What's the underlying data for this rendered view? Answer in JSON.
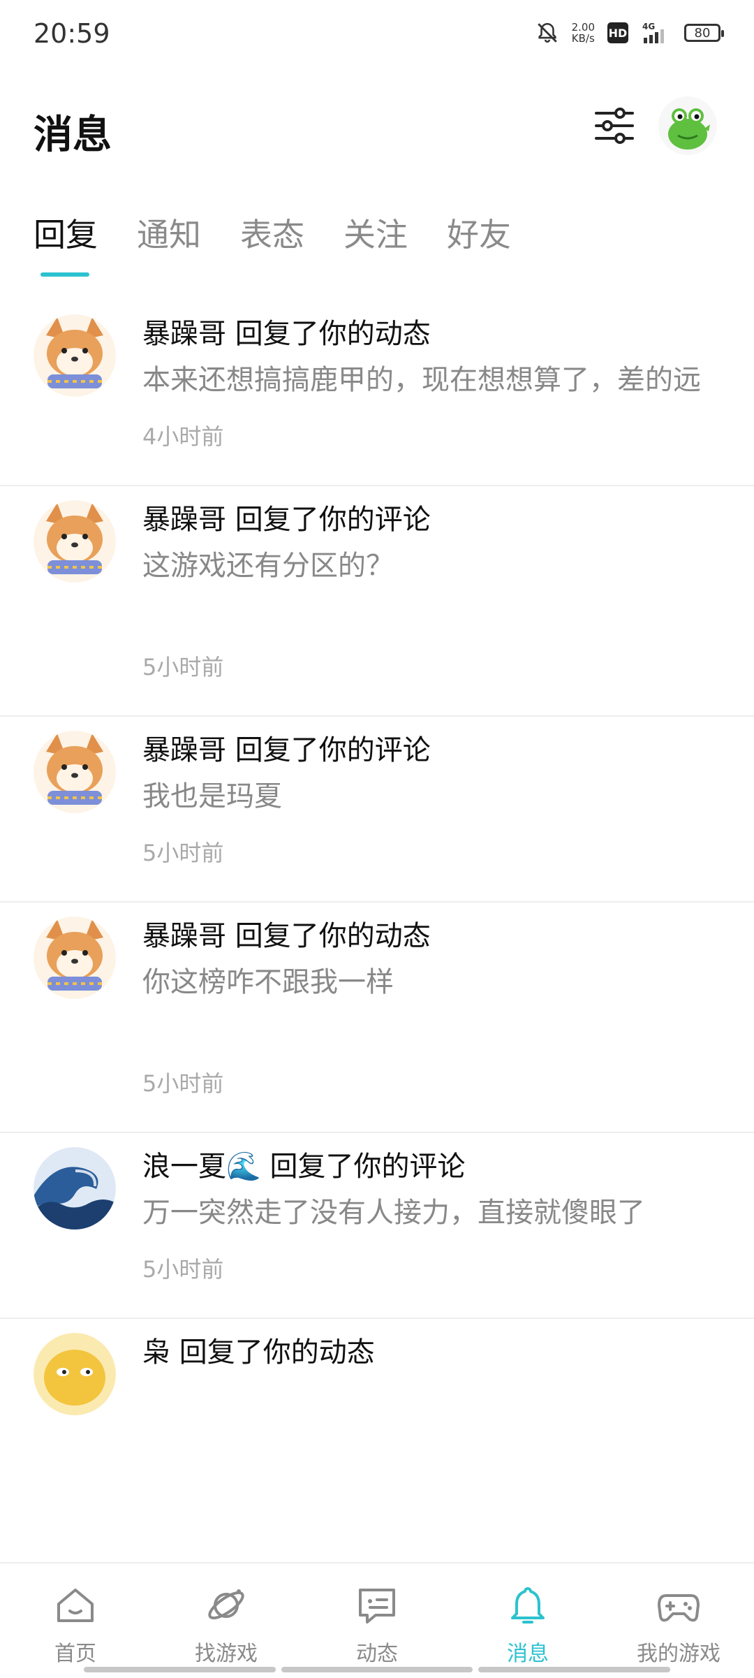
{
  "status_bar": {
    "time": "20:59",
    "net_speed_value": "2.00",
    "net_speed_unit": "KB/s",
    "hd": "HD",
    "network": "4G",
    "battery": "80"
  },
  "header": {
    "title": "消息",
    "filter_icon": "sliders-icon",
    "avatar_icon": "frog-avatar"
  },
  "tabs": [
    {
      "label": "回复",
      "active": true
    },
    {
      "label": "通知"
    },
    {
      "label": "表态"
    },
    {
      "label": "关注"
    },
    {
      "label": "好友"
    }
  ],
  "messages": [
    {
      "title": "暴躁哥 回复了你的动态",
      "body": "本来还想搞搞鹿甲的，现在想想算了，差的远",
      "time": "4小时前",
      "avatar": "shiba-avatar"
    },
    {
      "title": "暴躁哥 回复了你的评论",
      "body": "这游戏还有分区的？",
      "time": "5小时前",
      "avatar": "shiba-avatar"
    },
    {
      "title": "暴躁哥 回复了你的评论",
      "body": "我也是玛夏",
      "time": "5小时前",
      "avatar": "shiba-avatar"
    },
    {
      "title": "暴躁哥 回复了你的动态",
      "body": "你这榜咋不跟我一样",
      "time": "5小时前",
      "avatar": "shiba-avatar"
    },
    {
      "title": "浪一夏🌊 回复了你的评论",
      "body": "万一突然走了没有人接力，直接就傻眼了",
      "time": "5小时前",
      "avatar": "wave-avatar"
    },
    {
      "title": "枭 回复了你的动态",
      "body": "",
      "time": "",
      "avatar": "dog-avatar"
    }
  ],
  "bottom_nav": [
    {
      "label": "首页",
      "icon": "home-icon"
    },
    {
      "label": "找游戏",
      "icon": "planet-icon"
    },
    {
      "label": "动态",
      "icon": "chat-icon"
    },
    {
      "label": "消息",
      "icon": "bell-icon",
      "active": true
    },
    {
      "label": "我的游戏",
      "icon": "gamepad-icon"
    }
  ],
  "colors": {
    "accent": "#2cc2cf",
    "muted": "#8a8a8a"
  }
}
